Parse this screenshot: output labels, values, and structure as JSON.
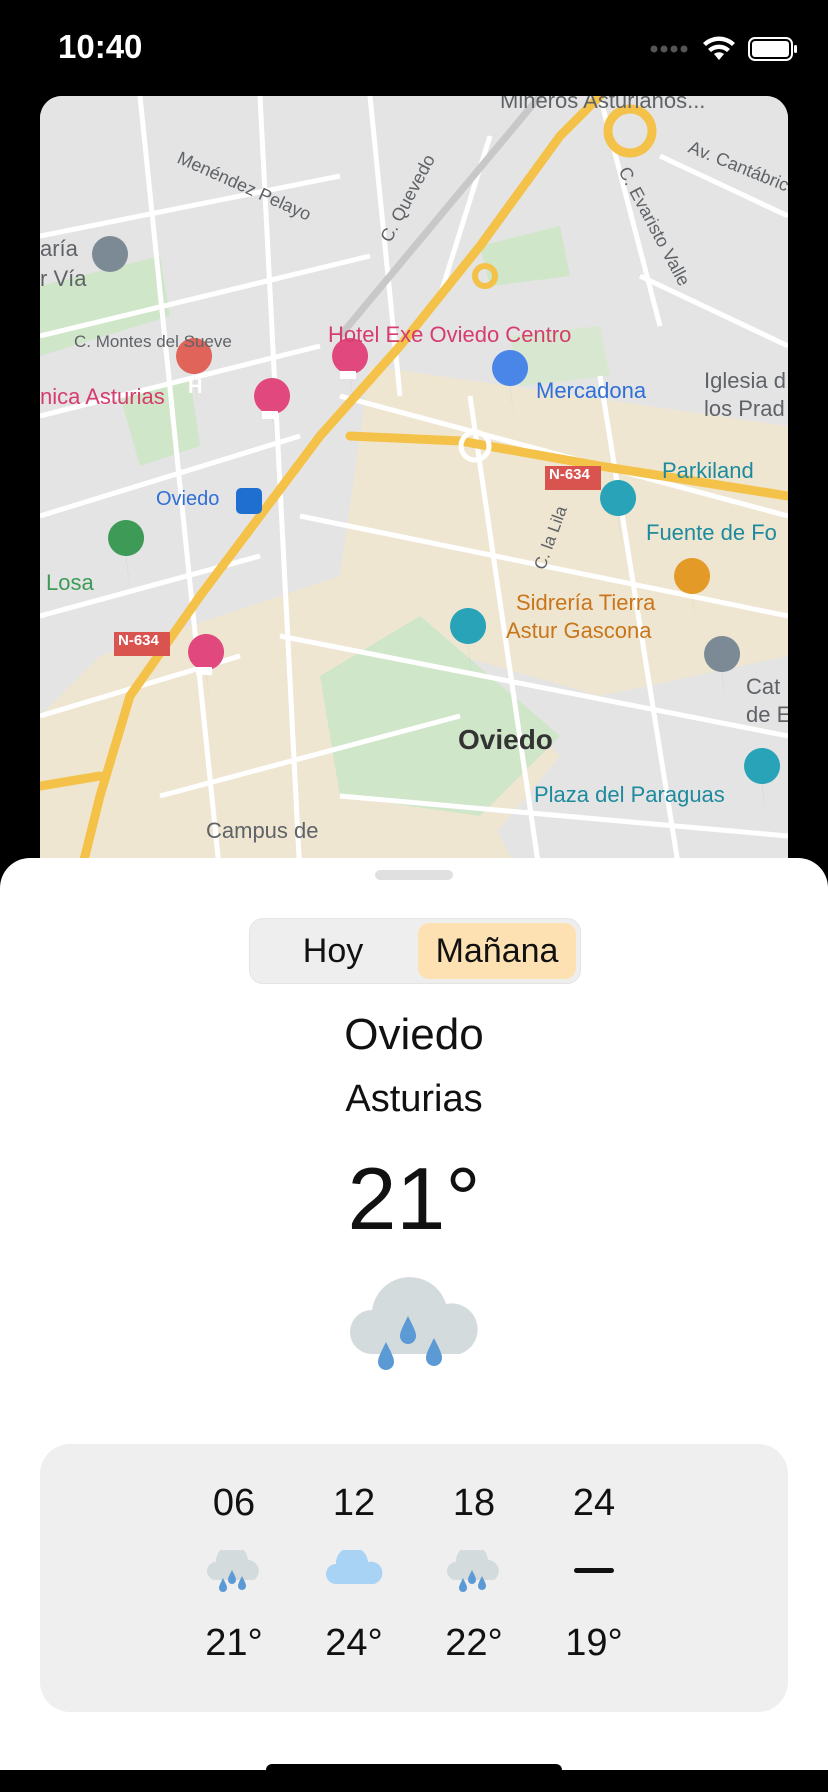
{
  "status_bar": {
    "time": "10:40"
  },
  "map": {
    "labels": {
      "mineros": "Mineros Asturianos...",
      "av_cantabrico": "Av. Cantábrico",
      "menendez": "Menéndez Pelayo",
      "quevedo": "C. Quevedo",
      "evaristo": "C. Evaristo Valle",
      "maria": "aría",
      "via": "r Vía",
      "montes": "C. Montes del Sueve",
      "hotel": "Hotel Exe Oviedo Centro",
      "mercadona": "Mercadona",
      "iglesia1": "Iglesia d",
      "iglesia2": "los Prad",
      "clinica": "nica Asturias",
      "parkiland": "Parkiland",
      "n634_1": "N-634",
      "n634_2": "N-634",
      "oviedo_bus": "Oviedo",
      "lila": "C. la Lila",
      "fuente": "Fuente de Fo",
      "losa": "Losa",
      "sidreria1": "Sidrería Tierra",
      "sidreria2": "Astur Gascona",
      "cat1": "Cat",
      "cat2": "de E",
      "oviedo_city": "Oviedo",
      "plaza": "Plaza del Paraguas",
      "campus": "Campus de"
    }
  },
  "segmented": {
    "today": "Hoy",
    "tomorrow": "Mañana",
    "selected": "tomorrow"
  },
  "location": {
    "city": "Oviedo",
    "region": "Asturias"
  },
  "current": {
    "temp": "21°",
    "icon": "rain-cloud-icon"
  },
  "hourly": [
    {
      "hour": "06",
      "icon": "rain-cloud-icon",
      "temp": "21°"
    },
    {
      "hour": "12",
      "icon": "cloud-icon",
      "temp": "24°"
    },
    {
      "hour": "18",
      "icon": "rain-cloud-icon",
      "temp": "22°"
    },
    {
      "hour": "24",
      "icon": "dash-icon",
      "temp": "19°"
    }
  ],
  "colors": {
    "selected_segment": "#fde1b3",
    "rain_drop": "#5c9ad6",
    "cloud_gray": "#d3dbdd",
    "cloud_blue": "#a8d3f5"
  }
}
